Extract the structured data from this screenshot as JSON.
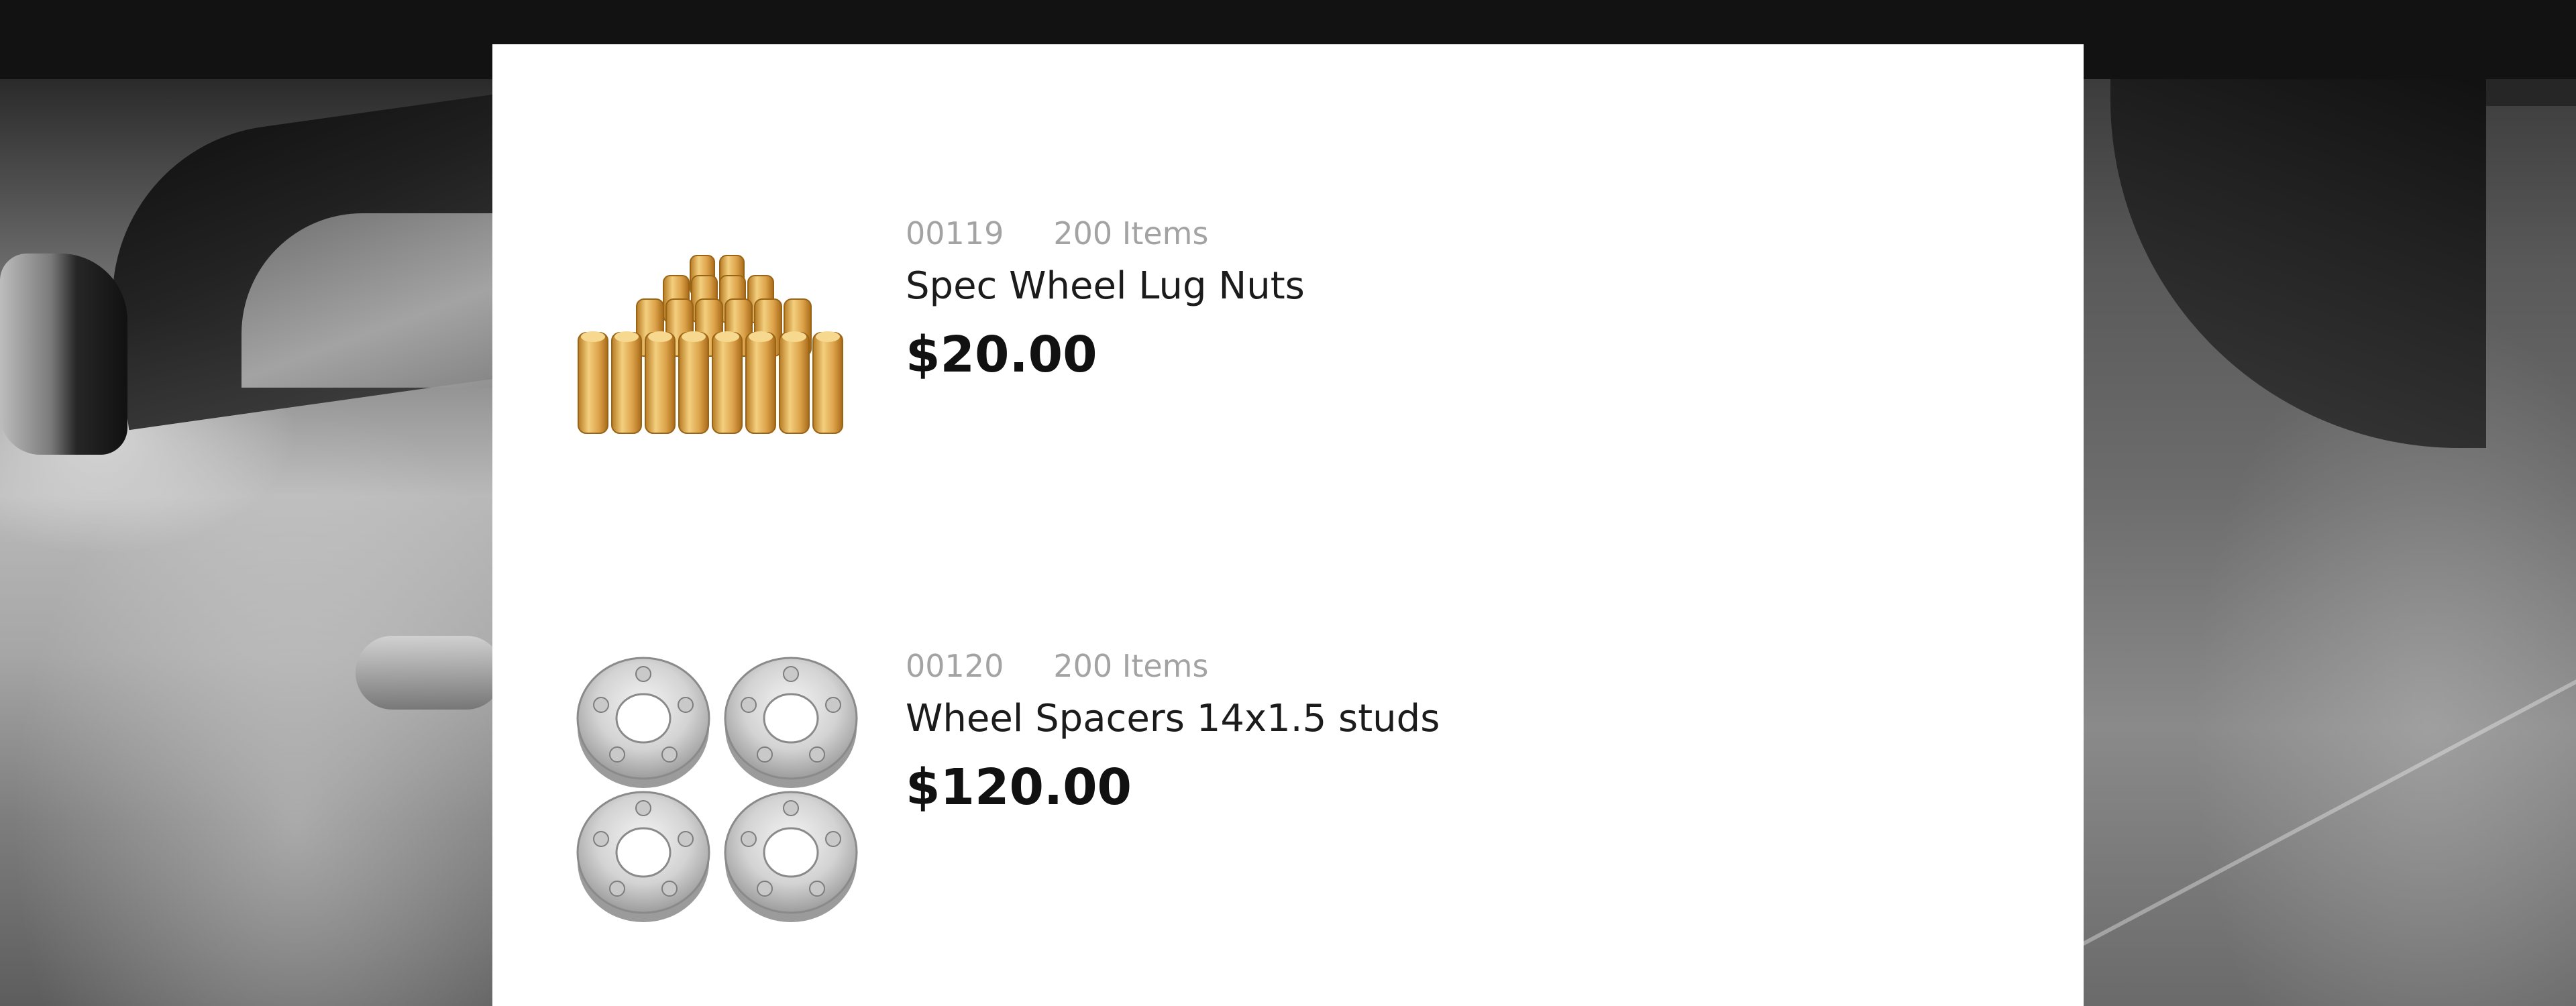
{
  "products": [
    {
      "sku": "00119",
      "items": "200 Items",
      "name": "Spec Wheel Lug Nuts",
      "price": "$20.00",
      "image_icon": "lug-nuts-image"
    },
    {
      "sku": "00120",
      "items": "200 Items",
      "name": "Wheel Spacers 14x1.5 studs",
      "price": "$120.00",
      "image_icon": "wheel-spacers-image"
    }
  ],
  "colors": {
    "top_bar": "#121212",
    "panel": "#ffffff",
    "meta_text": "#a3a3a3",
    "name_text": "#1b1b1b",
    "price_text": "#111111",
    "lug_nut_gold": "#e0a84a"
  }
}
